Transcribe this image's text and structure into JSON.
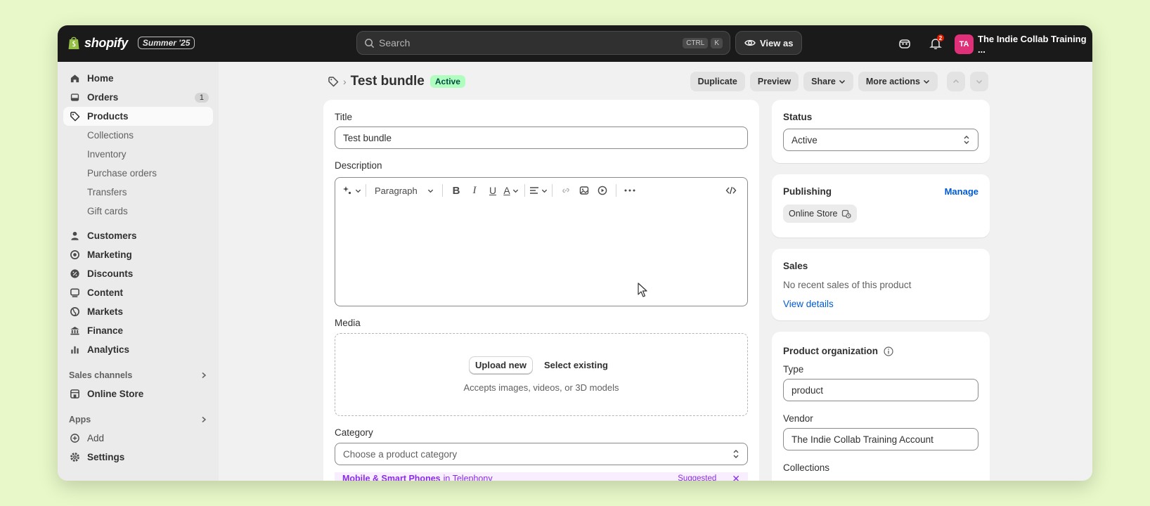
{
  "topbar": {
    "brand": "shopify",
    "edition": "Summer '25",
    "search_placeholder": "Search",
    "shortcut_keys": [
      "CTRL",
      "K"
    ],
    "view_as_label": "View as",
    "notification_count": "2",
    "store_initials": "TA",
    "store_name": "The Indie Collab Training ...",
    "colors": {
      "bar": "#1a1a1a",
      "avatar": "#e0307a"
    }
  },
  "sidebar": {
    "items": [
      {
        "label": "Home",
        "icon": "home-icon"
      },
      {
        "label": "Orders",
        "icon": "inbox-icon",
        "count": "1"
      },
      {
        "label": "Products",
        "icon": "tag-icon",
        "active": true
      }
    ],
    "product_subitems": [
      "Collections",
      "Inventory",
      "Purchase orders",
      "Transfers",
      "Gift cards"
    ],
    "items2": [
      {
        "label": "Customers",
        "icon": "person-icon"
      },
      {
        "label": "Marketing",
        "icon": "target-icon"
      },
      {
        "label": "Discounts",
        "icon": "discount-icon"
      },
      {
        "label": "Content",
        "icon": "content-icon"
      },
      {
        "label": "Markets",
        "icon": "globe-icon"
      },
      {
        "label": "Finance",
        "icon": "bank-icon"
      },
      {
        "label": "Analytics",
        "icon": "bar-chart-icon"
      }
    ],
    "sales_channels_title": "Sales channels",
    "online_store_label": "Online Store",
    "apps_title": "Apps",
    "add_label": "Add",
    "settings_label": "Settings"
  },
  "page": {
    "title": "Test bundle",
    "status_badge": "Active",
    "actions": {
      "duplicate": "Duplicate",
      "preview": "Preview",
      "share": "Share",
      "more": "More actions"
    }
  },
  "main_card": {
    "title_label": "Title",
    "title_value": "Test bundle",
    "description_label": "Description",
    "paragraph_label": "Paragraph",
    "media_label": "Media",
    "upload_new": "Upload new",
    "select_existing": "Select existing",
    "media_hint": "Accepts images, videos, or 3D models",
    "category_label": "Category",
    "category_placeholder": "Choose a product category",
    "suggestion_name": "Mobile & Smart Phones",
    "suggestion_in": "in Telephony",
    "suggestion_tag": "Suggested"
  },
  "status_card": {
    "label": "Status",
    "value": "Active"
  },
  "publishing_card": {
    "title": "Publishing",
    "manage": "Manage",
    "channel": "Online Store"
  },
  "sales_card": {
    "title": "Sales",
    "text": "No recent sales of this product",
    "link": "View details"
  },
  "org_card": {
    "title": "Product organization",
    "type_label": "Type",
    "type_value": "product",
    "vendor_label": "Vendor",
    "vendor_value": "The Indie Collab Training Account",
    "collections_label": "Collections"
  }
}
